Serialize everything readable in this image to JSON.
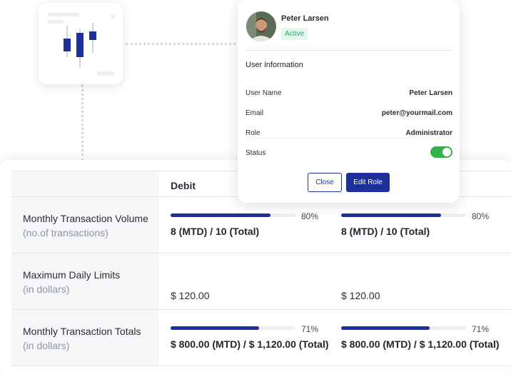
{
  "accent": "#1f2f99",
  "user_card": {
    "name": "Peter Larsen",
    "status_badge": "Active",
    "section_title": "User information",
    "fields": [
      {
        "label": "User Name",
        "value": "Peter Larsen"
      },
      {
        "label": "Email",
        "value": "peter@yourmail.com"
      },
      {
        "label": "Role",
        "value": "Administrator"
      }
    ],
    "status_label": "Status",
    "status_enabled": true,
    "close_label": "Close",
    "edit_role_label": "Edit Role"
  },
  "widget": {
    "icon": "candlestick-chart-icon"
  },
  "table": {
    "columns": [
      "",
      "Debit",
      ""
    ],
    "rows": [
      {
        "label": "Monthly Transaction Volume",
        "sublabel": "(no.of transactions)",
        "cells": [
          {
            "progress_percent": 80,
            "percent_text": "80%",
            "value": "8 (MTD) / 10 (Total)"
          },
          {
            "progress_percent": 80,
            "percent_text": "80%",
            "value": "8 (MTD) / 10 (Total)"
          }
        ]
      },
      {
        "label": "Maximum Daily Limits",
        "sublabel": "(in dollars)",
        "cells": [
          {
            "value": "$ 120.00"
          },
          {
            "value": "$ 120.00"
          }
        ]
      },
      {
        "label": "Monthly Transaction Totals",
        "sublabel": "(in dollars)",
        "cells": [
          {
            "progress_percent": 71,
            "percent_text": "71%",
            "value": "$ 800.00 (MTD) / $ 1,120.00 (Total)"
          },
          {
            "progress_percent": 71,
            "percent_text": "71%",
            "value": "$ 800.00 (MTD) / $ 1,120.00 (Total)"
          }
        ]
      }
    ]
  }
}
